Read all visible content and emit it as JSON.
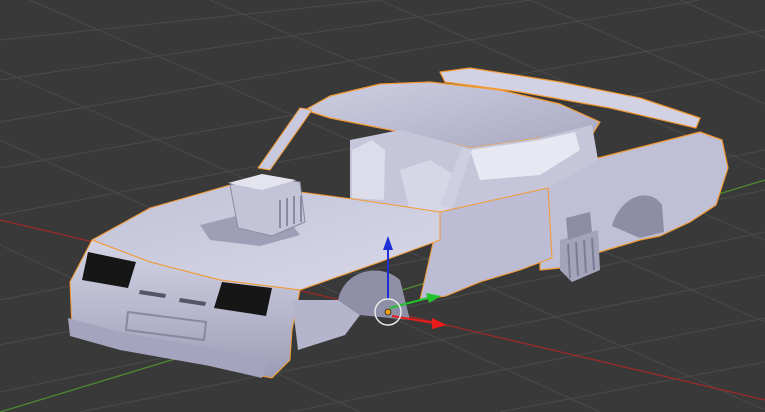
{
  "viewport": {
    "background_color": "#393939",
    "grid_color": "#4a4a4a",
    "x_axis_color": "#9b2a2a",
    "y_axis_color": "#4e8a2e",
    "selection_outline_color": "#f39a33",
    "model_color": "#b9b9d2",
    "window_color": "#161616",
    "selected_object": "car-body",
    "gizmo": {
      "z_axis_color": "#1f2fd8",
      "y_axis_color": "#22c42b",
      "x_axis_color": "#e81c1c",
      "origin_color": "#f0a000"
    }
  }
}
